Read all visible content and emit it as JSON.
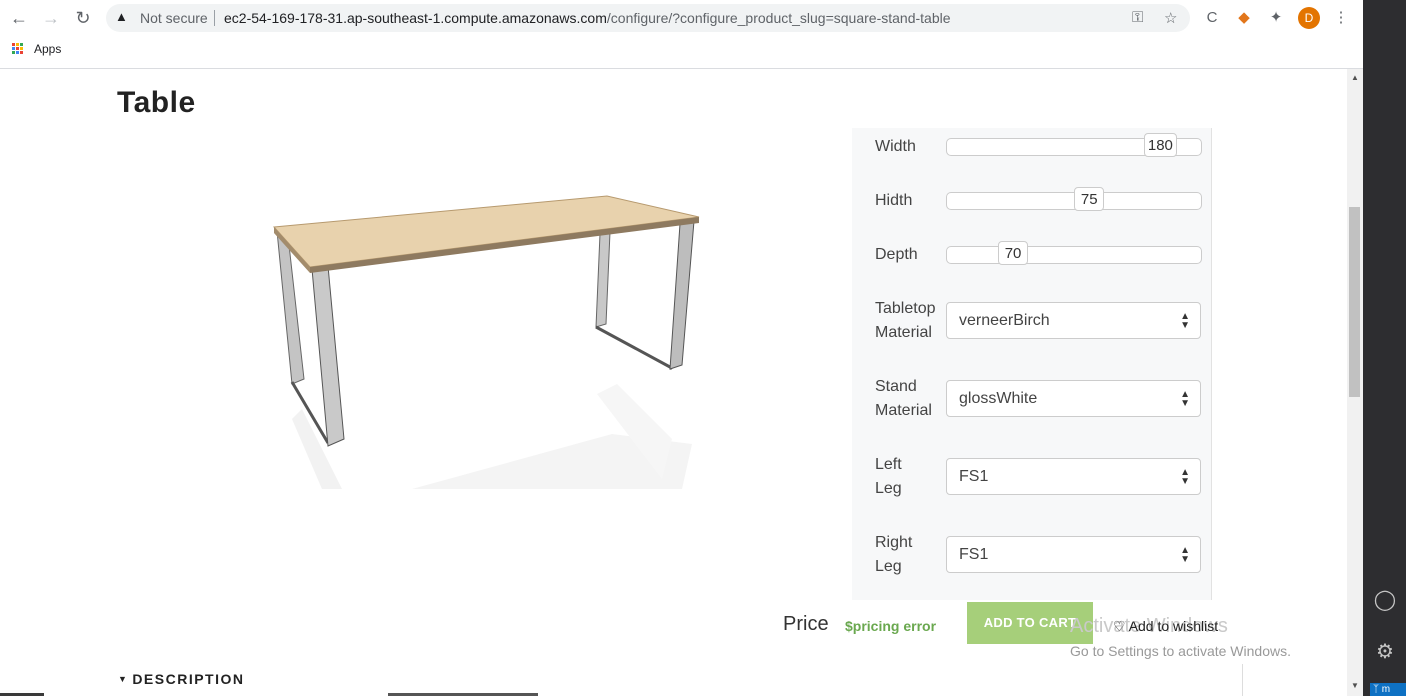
{
  "browser": {
    "security_label": "Not secure",
    "url_host": "ec2-54-169-178-31.ap-southeast-1.compute.amazonaws.com",
    "url_path": "/configure/?configure_product_slug=square-stand-table",
    "avatar_letter": "D",
    "bookmarks_apps_label": "Apps"
  },
  "page": {
    "title": "Table"
  },
  "configurator": {
    "sliders": [
      {
        "label": "Width",
        "value": "180",
        "fraction": 0.84
      },
      {
        "label": "Hidth",
        "value": "75",
        "fraction": 0.56
      },
      {
        "label": "Depth",
        "value": "70",
        "fraction": 0.26
      }
    ],
    "tabletop": {
      "label_line1": "Tabletop",
      "label_line2": "Material",
      "value": "verneerBirch"
    },
    "stand": {
      "label_line1": "Stand",
      "label_line2": "Material",
      "value": "glossWhite"
    },
    "left_leg": {
      "label_line1": "Left",
      "label_line2": "Leg",
      "value": "FS1"
    },
    "right_leg": {
      "label_line1": "Right",
      "label_line2": "Leg",
      "value": "FS1"
    }
  },
  "purchase": {
    "price_label": "Price",
    "price_value": "$pricing error",
    "add_to_cart": "ADD TO CART",
    "wishlist": "Add to wishlist"
  },
  "description_label": "DESCRIPTION",
  "windows_watermark": {
    "line1": "Activate Windows",
    "line2": "Go to Settings to activate Windows."
  },
  "colors": {
    "accent_green": "#a6cf7a",
    "price_green": "#6aa84f",
    "tabletop_wood": "#e8d2ad"
  }
}
